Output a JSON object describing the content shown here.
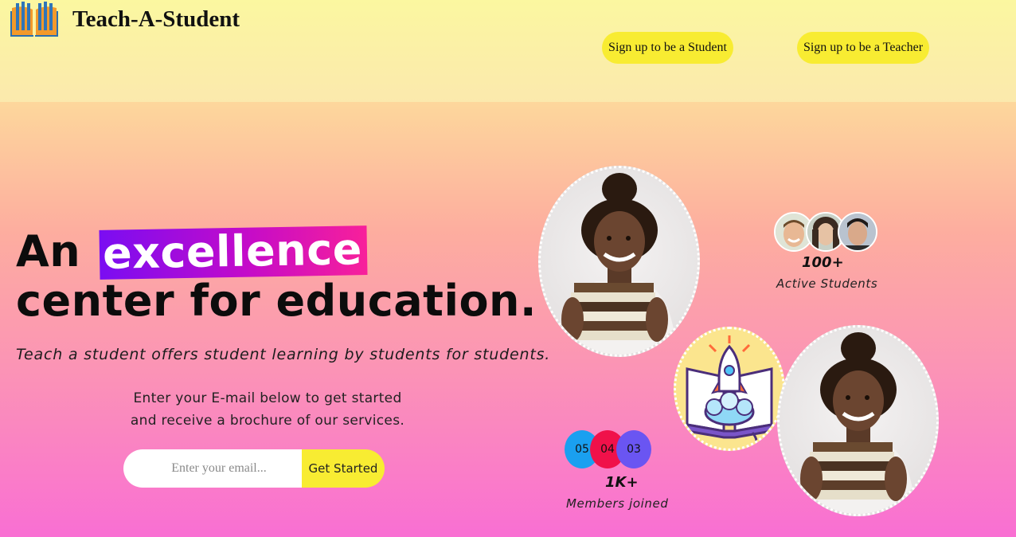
{
  "header": {
    "brand": "Teach-A-Student",
    "nav": {
      "student_signup": "Sign up to be a Student",
      "teacher_signup": "Sign up to be a Teacher"
    }
  },
  "hero": {
    "headline_prefix": "An",
    "headline_highlight": "excellence",
    "headline_line2": "center for education.",
    "tagline": "Teach a student  offers student learning by students for students.",
    "cta_line1": "Enter your E-mail below to get started",
    "cta_line2": "and receive a brochure of our services.",
    "email_placeholder": "Enter your email...",
    "submit_label": "Get Started"
  },
  "stats": {
    "active_students": {
      "value": "100+",
      "label": "Active Students"
    },
    "members": {
      "value": "1K+",
      "label": "Members joined",
      "counters": [
        {
          "text": "05",
          "color": "#1aa0f0"
        },
        {
          "text": "04",
          "color": "#f0114a"
        },
        {
          "text": "03",
          "color": "#6a55f2"
        }
      ]
    }
  },
  "colors": {
    "accent_yellow": "#f8ec32",
    "highlight_start": "#7a0df2",
    "highlight_end": "#f8209a"
  }
}
